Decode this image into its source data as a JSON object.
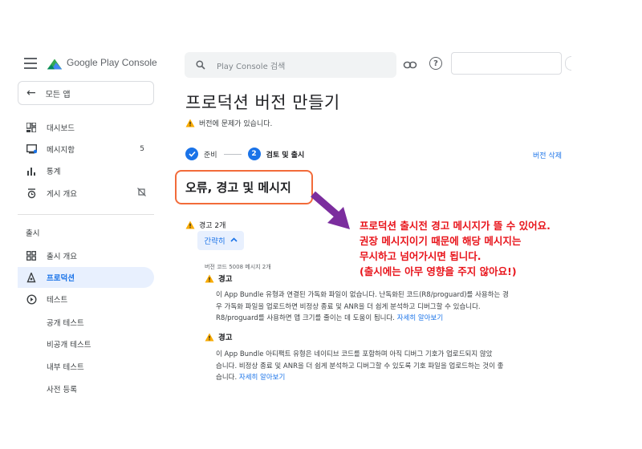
{
  "app": {
    "logo_text": "Google Play Console",
    "logo_icon": "play-console-logo-icon"
  },
  "sidebar": {
    "all_apps": "모든 앱",
    "items": [
      {
        "label": "대시보드",
        "icon": "dashboard-icon"
      },
      {
        "label": "메시지함",
        "icon": "inbox-icon",
        "count": "5"
      },
      {
        "label": "통계",
        "icon": "bar-chart-icon"
      },
      {
        "label": "게시 개요",
        "icon": "publishing-overview-icon"
      }
    ],
    "section_label": "출시",
    "release_items": [
      {
        "label": "출시 개요",
        "icon": "release-overview-icon"
      },
      {
        "label": "프로덕션",
        "icon": "production-icon",
        "active": true
      },
      {
        "label": "테스트",
        "icon": "testing-icon"
      }
    ],
    "sub_items": [
      "공개 테스트",
      "비공개 테스트",
      "내부 테스트",
      "사전 등록"
    ]
  },
  "header": {
    "search_placeholder": "Play Console 검색"
  },
  "main": {
    "title": "프로덕션 버전 만들기",
    "warning_line": "버전에 문제가 있습니다.",
    "steps": [
      {
        "label": "준비",
        "state": "done"
      },
      {
        "number": "2",
        "label": "검토 및 출시",
        "state": "current"
      }
    ],
    "delete_release": "버전 삭제",
    "section_title": "오류, 경고 및 메시지",
    "warnings_count": "경고 2개",
    "collapse_label": "간략히",
    "build_label": "버전 코드 5008 메시지 2개",
    "warnings": [
      {
        "title": "경고",
        "lines": [
          "이 App Bundle 유형과 연결된 가독화 파일이 없습니다. 난독화된 코드(R8/proguard)를 사용하는 경",
          "우 가독화 파일을 업로드하면 비정상 종료 및 ANR을 더 쉽게 분석하고 디버그할 수 있습니다.",
          "R8/proguard를 사용하면 앱 크기를 줄이는 데 도움이 됩니다."
        ],
        "link": "자세히 알아보기"
      },
      {
        "title": "경고",
        "lines": [
          "이 App Bundle 아티팩트 유형은 네이티브 코드를 포함하며 아직 디버그 기호가 업로드되지 않았",
          "습니다. 비정상 종료 및 ANR을 더 쉽게 분석하고 디버그할 수 있도록 기호 파일을 업로드하는 것이 좋",
          "습니다."
        ],
        "link": "자세히 알아보기"
      }
    ]
  },
  "annotation": {
    "lines": [
      "프로덕션 출시전 경고 메시지가 뜰 수 있어요.",
      "권장 메시지이기 때문에 해당 메시지는",
      "무시하고 넘어가시면 됩니다.",
      "(출시에는 아무 영향을 주지 않아요!)"
    ],
    "color": "#e8141b",
    "arrow_color": "#7b2d9e",
    "box_color": "#f26b3a"
  },
  "colors": {
    "accent": "#1a73e8",
    "warning": "#f9ab00"
  }
}
